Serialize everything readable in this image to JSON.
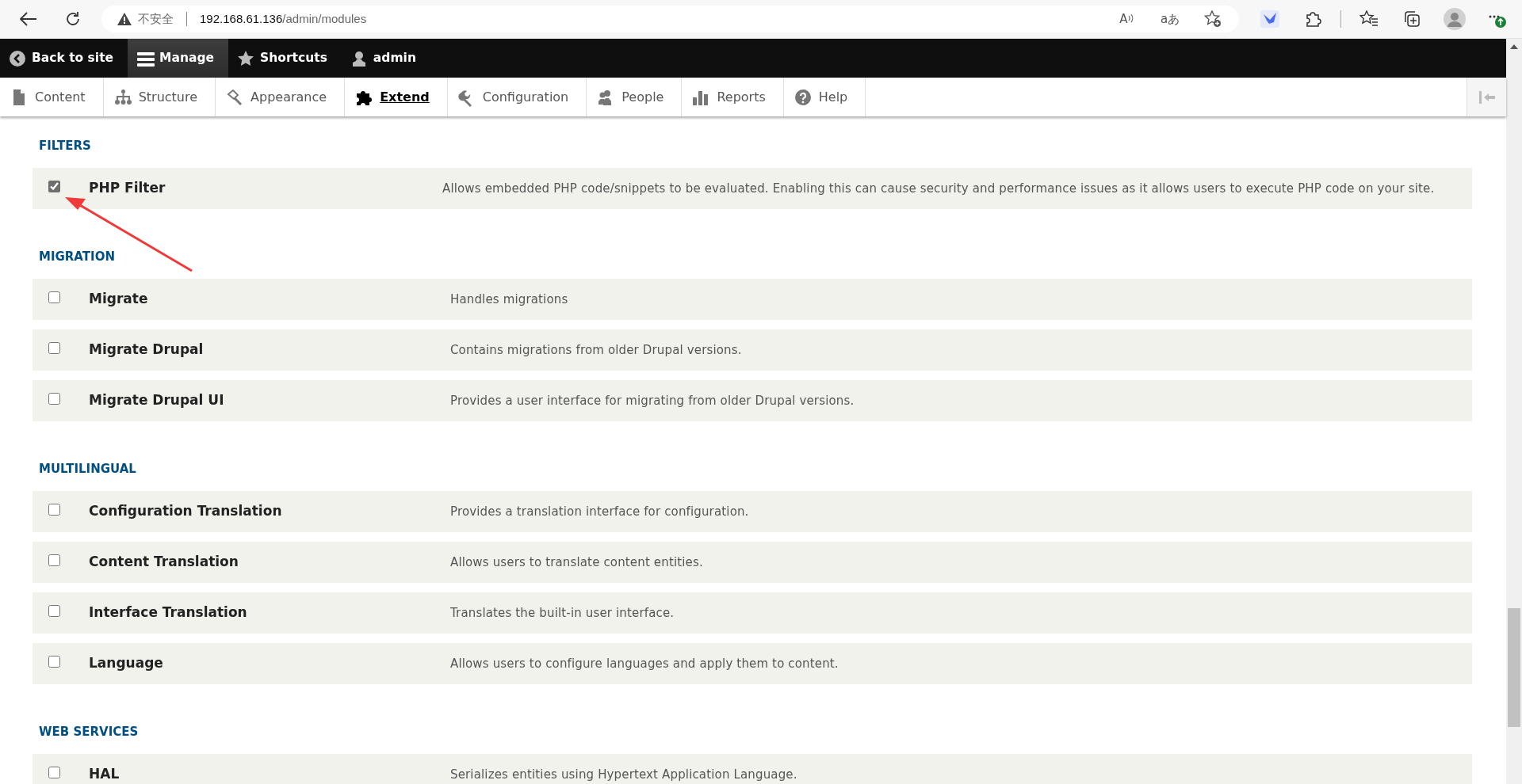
{
  "browser": {
    "security_label": "不安全",
    "url_host": "192.168.61.136",
    "url_path": "/admin/modules",
    "read_aloud_label": "A",
    "translate_label": "aあ"
  },
  "toolbar": {
    "items": [
      {
        "label": "Back to site",
        "selected": false
      },
      {
        "label": "Manage",
        "selected": true
      },
      {
        "label": "Shortcuts",
        "selected": false
      },
      {
        "label": "admin",
        "selected": false
      }
    ]
  },
  "tray": {
    "items": [
      {
        "label": "Content",
        "selected": false
      },
      {
        "label": "Structure",
        "selected": false
      },
      {
        "label": "Appearance",
        "selected": false
      },
      {
        "label": "Extend",
        "selected": true
      },
      {
        "label": "Configuration",
        "selected": false
      },
      {
        "label": "People",
        "selected": false
      },
      {
        "label": "Reports",
        "selected": false
      },
      {
        "label": "Help",
        "selected": false
      }
    ]
  },
  "sections": [
    {
      "title": "FILTERS",
      "modules": [
        {
          "name": "PHP Filter",
          "description": "Allows embedded PHP code/snippets to be evaluated. Enabling this can cause security and performance issues as it allows users to execute PHP code on your site.",
          "checked": true
        }
      ]
    },
    {
      "title": "MIGRATION",
      "modules": [
        {
          "name": "Migrate",
          "description": "Handles migrations",
          "checked": false
        },
        {
          "name": "Migrate Drupal",
          "description": "Contains migrations from older Drupal versions.",
          "checked": false
        },
        {
          "name": "Migrate Drupal UI",
          "description": "Provides a user interface for migrating from older Drupal versions.",
          "checked": false
        }
      ]
    },
    {
      "title": "MULTILINGUAL",
      "modules": [
        {
          "name": "Configuration Translation",
          "description": "Provides a translation interface for configuration.",
          "checked": false
        },
        {
          "name": "Content Translation",
          "description": "Allows users to translate content entities.",
          "checked": false
        },
        {
          "name": "Interface Translation",
          "description": "Translates the built-in user interface.",
          "checked": false
        },
        {
          "name": "Language",
          "description": "Allows users to configure languages and apply them to content.",
          "checked": false
        }
      ]
    },
    {
      "title": "WEB SERVICES",
      "modules": [
        {
          "name": "HAL",
          "description": "Serializes entities using Hypertext Application Language.",
          "checked": false
        }
      ]
    }
  ]
}
